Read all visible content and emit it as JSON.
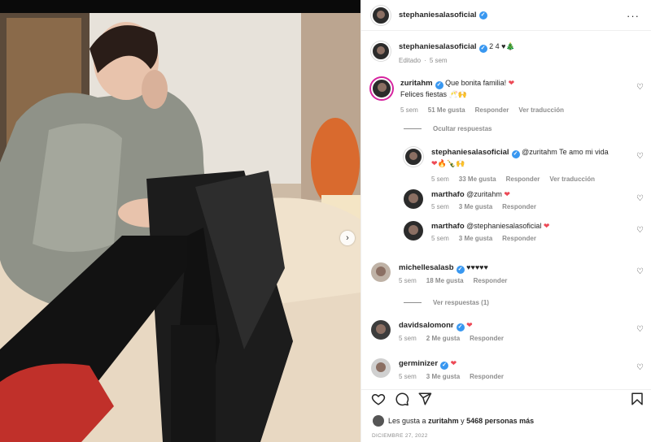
{
  "post": {
    "author": "stephaniesalasoficial",
    "more_icon": "more-horizontal-icon",
    "caption": {
      "author": "stephaniesalasoficial",
      "text": "2 4 ♥🎄",
      "edited": "Editado",
      "time": "5 sem"
    }
  },
  "comments": [
    {
      "user": "zuritahm",
      "text": "Que bonita familia! ❤️",
      "text2": "Felices fiestas 🥂🙌",
      "time": "5 sem",
      "likes": "51 Me gusta",
      "reply": "Responder",
      "translate": "Ver traducción"
    },
    {
      "user": "stephaniesalasoficial",
      "text": "@zuritahm Te amo mi vida",
      "text2": "❤️🔥🍾🙌",
      "time": "5 sem",
      "likes": "33 Me gusta",
      "reply": "Responder",
      "translate": "Ver traducción"
    },
    {
      "user": "marthafo",
      "text": "@zuritahm ❤️",
      "time": "5 sem",
      "likes": "3 Me gusta",
      "reply": "Responder"
    },
    {
      "user": "marthafo",
      "text": "@stephaniesalasoficial ❤️",
      "time": "5 sem",
      "likes": "3 Me gusta",
      "reply": "Responder"
    },
    {
      "user": "michellesalasb",
      "text": "♥♥♥♥♥",
      "time": "5 sem",
      "likes": "18 Me gusta",
      "reply": "Responder"
    },
    {
      "user": "davidsalomonr",
      "text": "❤️",
      "time": "5 sem",
      "likes": "2 Me gusta",
      "reply": "Responder"
    },
    {
      "user": "germinizer",
      "text": "❤️",
      "time": "5 sem",
      "likes": "3 Me gusta",
      "reply": "Responder"
    }
  ],
  "toggles": {
    "hide_replies": "Ocultar respuestas",
    "view_replies": "Ver respuestas (1)"
  },
  "footer": {
    "likes_prefix": "Les gusta a",
    "likes_user": "zuritahm",
    "likes_and": "y",
    "likes_count": "5468 personas más",
    "date": "DICIEMBRE 27, 2022"
  },
  "colors": {
    "verified": "#3897f0",
    "heart_red": "#ed4956"
  }
}
